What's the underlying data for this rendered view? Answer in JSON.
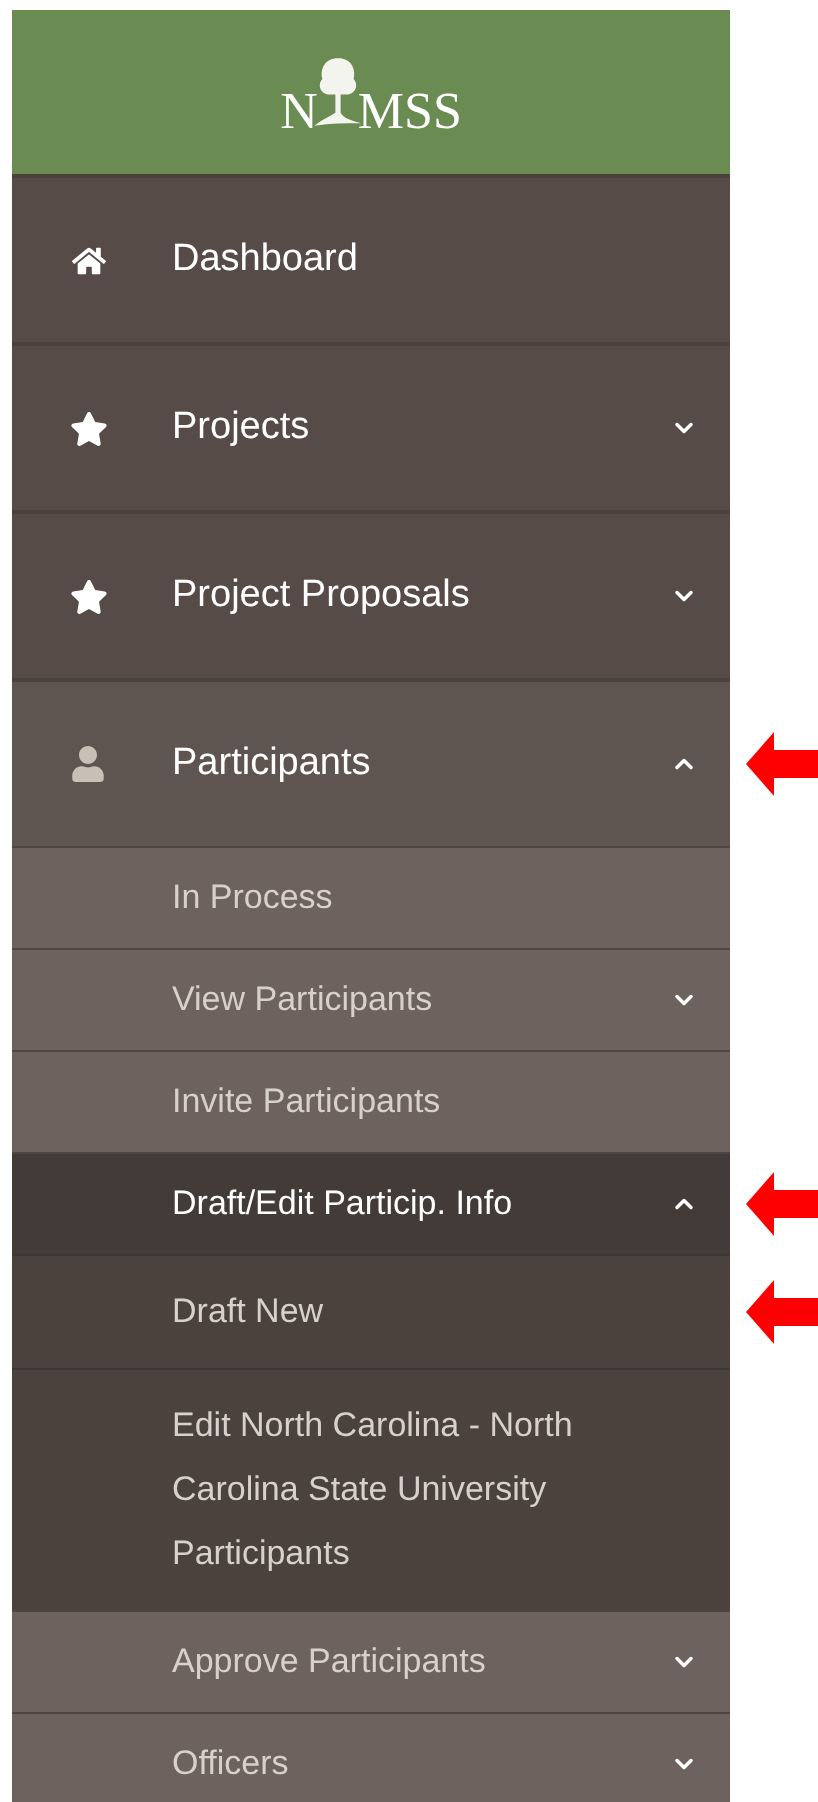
{
  "logo": {
    "left": "N",
    "right": "MSS"
  },
  "nav": [
    {
      "label": "Dashboard",
      "kind": "home",
      "annotated": false
    },
    {
      "label": "Projects",
      "kind": "star",
      "expanded": false,
      "annotated": false
    },
    {
      "label": "Project Proposals",
      "kind": "star",
      "expanded": false,
      "annotated": false
    },
    {
      "label": "Participants",
      "kind": "user",
      "expanded": true,
      "annotated": true,
      "children": [
        {
          "label": "In Process",
          "annotated": false
        },
        {
          "label": "View Participants",
          "expanded": false,
          "annotated": false
        },
        {
          "label": "Invite Participants",
          "annotated": false
        },
        {
          "label": "Draft/Edit Particip. Info",
          "expanded": true,
          "annotated": true,
          "children": [
            {
              "label": "Draft New",
              "annotated": true
            },
            {
              "label": "Edit North Carolina - North Carolina State University Participants",
              "annotated": false
            }
          ]
        },
        {
          "label": "Approve Participants",
          "expanded": false,
          "annotated": false
        },
        {
          "label": "Officers",
          "expanded": false,
          "annotated": false
        }
      ]
    }
  ]
}
